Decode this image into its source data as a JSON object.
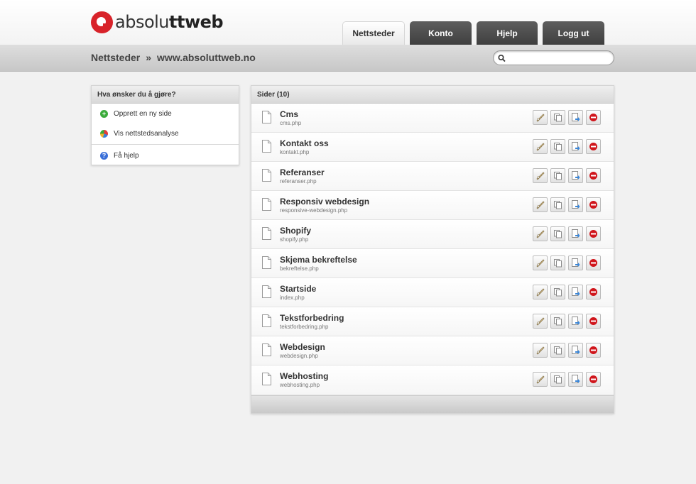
{
  "brand": {
    "logo_light": "absolu",
    "logo_bold": "ttweb",
    "accent": "#d8232a"
  },
  "tabs": [
    {
      "label": "Nettsteder",
      "active": true
    },
    {
      "label": "Konto",
      "active": false
    },
    {
      "label": "Hjelp",
      "active": false
    },
    {
      "label": "Logg ut",
      "active": false
    }
  ],
  "breadcrumb": {
    "root": "Nettsteder",
    "separator": "»",
    "current": "www.absoluttweb.no"
  },
  "search": {
    "value": "",
    "placeholder": ""
  },
  "sidebar": {
    "title": "Hva ønsker du å gjøre?",
    "items": [
      {
        "label": "Opprett en ny side",
        "icon": "plus-circle-icon"
      },
      {
        "label": "Vis nettstedsanalyse",
        "icon": "pie-chart-icon"
      },
      {
        "label": "Få hjelp",
        "icon": "help-icon"
      }
    ]
  },
  "pages": {
    "title": "Sider (10)",
    "rows": [
      {
        "title": "Cms",
        "file": "cms.php"
      },
      {
        "title": "Kontakt oss",
        "file": "kontakt.php"
      },
      {
        "title": "Referanser",
        "file": "referanser.php"
      },
      {
        "title": "Responsiv webdesign",
        "file": "responsive-webdesign.php"
      },
      {
        "title": "Shopify",
        "file": "shopify.php"
      },
      {
        "title": "Skjema bekreftelse",
        "file": "bekreftelse.php"
      },
      {
        "title": "Startside",
        "file": "index.php"
      },
      {
        "title": "Tekstforbedring",
        "file": "tekstforbedring.php"
      },
      {
        "title": "Webdesign",
        "file": "webdesign.php"
      },
      {
        "title": "Webhosting",
        "file": "webhosting.php"
      }
    ]
  }
}
